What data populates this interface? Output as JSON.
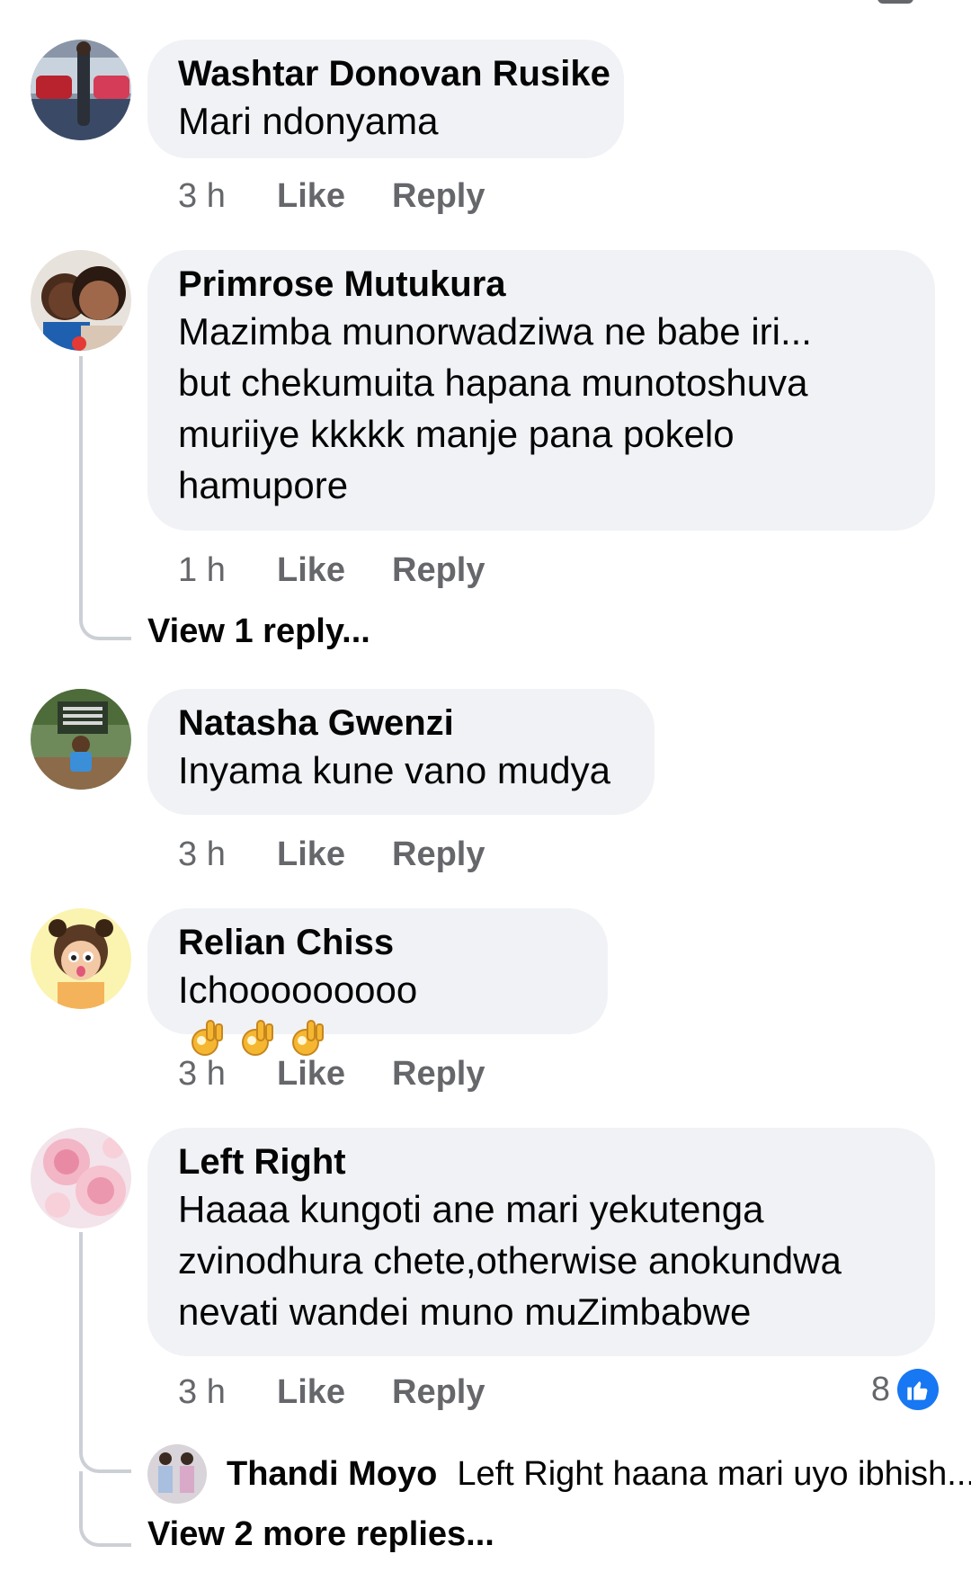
{
  "comments": [
    {
      "author": "Washtar Donovan Rusike",
      "text": "Mari ndonyama",
      "time": "3 h",
      "like_label": "Like",
      "reply_label": "Reply",
      "avatar": "avatar-photo-person-cars"
    },
    {
      "author": "Primrose Mutukura",
      "text": "Mazimba munorwadziwa ne babe iri...\nbut chekumuita hapana munotoshuva\nmuriiye kkkkk manje pana pokelo\nhamupore",
      "time": "1 h",
      "like_label": "Like",
      "reply_label": "Reply",
      "view_replies": "View 1 reply...",
      "avatar": "avatar-photo-two-people"
    },
    {
      "author": "Natasha Gwenzi",
      "text": "Inyama kune vano mudya",
      "time": "3 h",
      "like_label": "Like",
      "reply_label": "Reply",
      "avatar": "avatar-photo-victoria-falls-sign"
    },
    {
      "author": "Relian Chiss",
      "text": "Ichooooooooo",
      "emoji": "ok-hand-emoji",
      "emoji_count": 3,
      "time": "3 h",
      "like_label": "Like",
      "reply_label": "Reply",
      "avatar": "avatar-cartoon-girl"
    },
    {
      "author": "Left Right",
      "text": "Haaaa kungoti ane mari yekutenga\nzvinodhura chete,otherwise anokundwa\nnevati wandei muno muZimbabwe",
      "time": "3 h",
      "like_label": "Like",
      "reply_label": "Reply",
      "reaction_count": "8",
      "reaction_icon": "thumbs-up-icon",
      "avatar": "avatar-pink-roses",
      "reply_preview": {
        "author": "Thandi Moyo",
        "text": "Left Right haana mari uyo ibhish..."
      },
      "view_replies": "View 2 more replies..."
    }
  ],
  "colors": {
    "bubble": "#f0f2f5",
    "meta": "#65676b",
    "like_blue": "#1877f2",
    "thread_line": "#ccd0d5"
  }
}
